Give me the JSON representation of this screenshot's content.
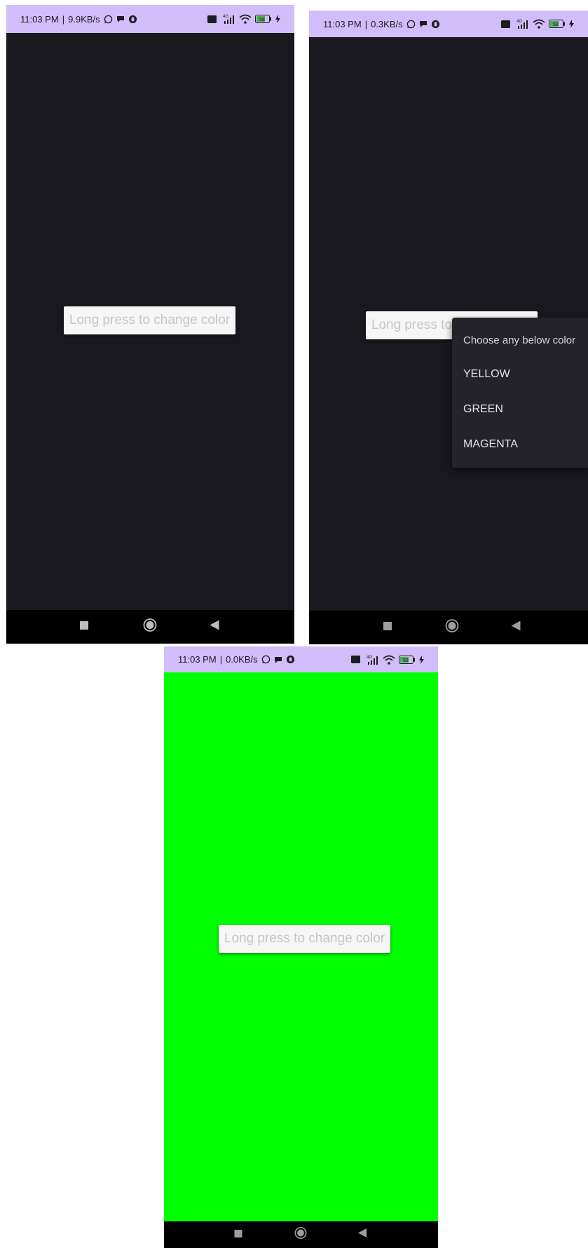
{
  "screens": [
    {
      "status": {
        "time": "11:03 PM",
        "speed": "9.9KB/s",
        "network": "4G",
        "battery": "58"
      },
      "button_label": "Long press to change color",
      "background_color": "#1a181f"
    },
    {
      "status": {
        "time": "11:03 PM",
        "speed": "0.3KB/s",
        "network": "4G",
        "battery": "58"
      },
      "button_label": "Long press to change color",
      "background_color": "#1a181f",
      "context_menu": {
        "title": "Choose any below color",
        "items": [
          "YELLOW",
          "GREEN",
          "MAGENTA"
        ]
      }
    },
    {
      "status": {
        "time": "11:03 PM",
        "speed": "0.0KB/s",
        "network": "4G",
        "battery": "58"
      },
      "button_label": "Long press to change color",
      "background_color": "#00ff00"
    }
  ],
  "colors": {
    "status_bar": "#d0bdf9",
    "nav_bar": "#000000",
    "menu_bg": "#24232a",
    "green": "#00ff00"
  },
  "icons": [
    "whatsapp-icon",
    "chat-icon",
    "app-icon",
    "volte-icon",
    "signal-icon",
    "wifi-icon",
    "battery-icon",
    "charging-icon",
    "recents-icon",
    "home-icon",
    "back-icon"
  ]
}
